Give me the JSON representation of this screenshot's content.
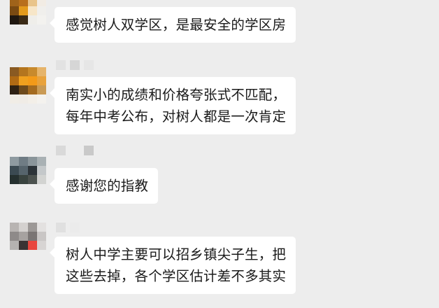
{
  "messages": [
    {
      "avatar": "pixelated-avatar",
      "name_visible": false,
      "lines": [
        "感觉树人双学区，是最安全的学区房"
      ],
      "colors": [
        "#a0631a",
        "#b86f1c",
        "#e9c48a",
        "#f2ece4",
        "#7a4a12",
        "#e39a1c",
        "#f7e6c8",
        "#f0efec",
        "#1f1710",
        "#3a2a16",
        "#efeeea",
        "#f3f2ef",
        "#ededed",
        "#ededed",
        "#ededed",
        "#ededed"
      ]
    },
    {
      "avatar": "pixelated-avatar",
      "name_visible": true,
      "lines": [
        "南实小的成绩和价格夸张式不匹配，",
        "每年中考公布，对树人都是一次肯定"
      ],
      "colors": [
        "#8a5a22",
        "#b4751e",
        "#c88a2c",
        "#e6b46a",
        "#b06a14",
        "#f0a01e",
        "#f39a18",
        "#e8a23c",
        "#2e2113",
        "#6e4a1c",
        "#a46b20",
        "#c99a54",
        "#f1ede6",
        "#f0ece6",
        "#f3efe8",
        "#f4f2ee"
      ]
    },
    {
      "avatar": "pixelated-avatar",
      "name_visible": true,
      "lines": [
        "感谢您的指教"
      ],
      "colors": [
        "#8e9aa0",
        "#6f7c84",
        "#8a959a",
        "#a9b1b4",
        "#3b4a52",
        "#56646c",
        "#2c3338",
        "#c4c8ca",
        "#25302f",
        "#39433f",
        "#4c524f",
        "#d2d3d1",
        "#ededed",
        "#ededed",
        "#ededed",
        "#ededed"
      ]
    },
    {
      "avatar": "pixelated-avatar",
      "name_visible": true,
      "lines": [
        "树人中学主要可以招乡镇尖子生，把",
        "这些去掉，各个学区估计差不多其实"
      ],
      "colors": [
        "#b8b4b2",
        "#d4d1cf",
        "#9c9896",
        "#e3e1e0",
        "#8e8a89",
        "#a6a2a0",
        "#7a7574",
        "#c9c6c5",
        "#b5b2b1",
        "#3a3333",
        "#e8463e",
        "#d7d4d3",
        "#ededed",
        "#ededed",
        "#ededed",
        "#ededed"
      ]
    }
  ]
}
